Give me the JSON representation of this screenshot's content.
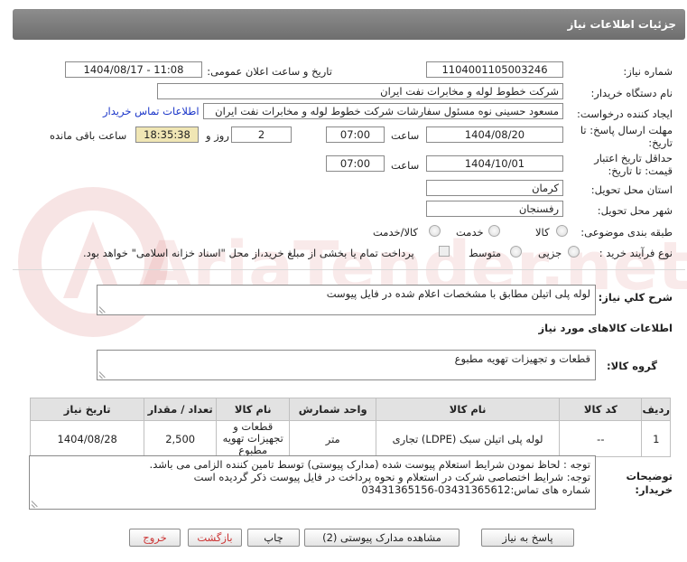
{
  "page_title": "جزئیات اطلاعات نیاز",
  "labels": {
    "need_number": "شماره نیاز:",
    "announce_date": "تاریخ و ساعت اعلان عمومی:",
    "buyer_org": "نام دستگاه خریدار:",
    "requester": "ایجاد کننده درخواست:",
    "deadline": "مهلت ارسال پاسخ: تا تاریخ:",
    "hour": "ساعت",
    "day_and": "روز و",
    "remaining": "ساعت باقی مانده",
    "validity": "حداقل تاریخ اعتبار قیمت: تا تاریخ:",
    "delivery_province": "استان محل تحویل:",
    "delivery_city": "شهر محل تحویل:",
    "category": "طبقه بندی موضوعی:",
    "purchase_type": "نوع فرآیند خرید :",
    "overall_desc": "شرح کلي نياز:",
    "goods_info": "اطلاعات کالاهای مورد نیاز",
    "goods_group": "گروه کالا:",
    "buyer_notes": "توضیحات خریدار:"
  },
  "values": {
    "need_number": "1104001105003246",
    "announce_date": "1404/08/17 - 11:08",
    "buyer_org": "شرکت خطوط لوله و مخابرات نفت ایران",
    "requester": "مسعود حسینی نوه  مسئول سفارشات  شرکت خطوط لوله و مخابرات نفت ایران",
    "contact_link": "اطلاعات تماس خریدار",
    "deadline_date": "1404/08/20",
    "deadline_time": "07:00",
    "days": "2",
    "countdown": "18:35:38",
    "validity_date": "1404/10/01",
    "validity_time": "07:00",
    "province": "کرمان",
    "city": "رفسنجان",
    "overall_desc": "لوله پلی اتیلن مطابق با مشخصات اعلام شده در فایل پیوست",
    "goods_group": "قطعات و تجهیزات تهویه مطبوع",
    "buyer_notes": [
      "توجه : لحاظ نمودن شرایط استعلام پیوست شده (مدارک پیوستی) توسط تامین کننده الزامی می باشد.",
      "توجه: شرایط اختصاصی شرکت در استعلام و نحوه پرداخت در فایل پیوست ذکر گردیده است",
      "شماره های تماس:03431365612-03431365156"
    ]
  },
  "category_options": [
    "کالا",
    "خدمت",
    "کالا/خدمت"
  ],
  "purchase_options": [
    "جزیی",
    "متوسط"
  ],
  "payment_note": "پرداخت تمام یا بخشی از مبلغ خرید،از محل \"اسناد خزانه اسلامی\" خواهد بود.",
  "table": {
    "headers": [
      "ردیف",
      "کد کالا",
      "نام کالا",
      "واحد شمارش",
      "تعداد / مقدار",
      "تاریخ نیاز"
    ],
    "rows": [
      [
        "1",
        "--",
        "لوله پلی اتیلن سبک (LDPE) تجاری",
        "متر",
        "2,500",
        "1404/08/28"
      ]
    ],
    "extra_column_header": "نام کالا",
    "extra_column_value": "قطعات و تجهیزات تهویه مطبوع"
  },
  "buttons": {
    "reply": "پاسخ به نیاز",
    "attachments": "مشاهده مدارک پیوستی (2)",
    "print": "چاپ",
    "back": "بازگشت",
    "exit": "خروج"
  },
  "watermark": "AriaTender.net"
}
